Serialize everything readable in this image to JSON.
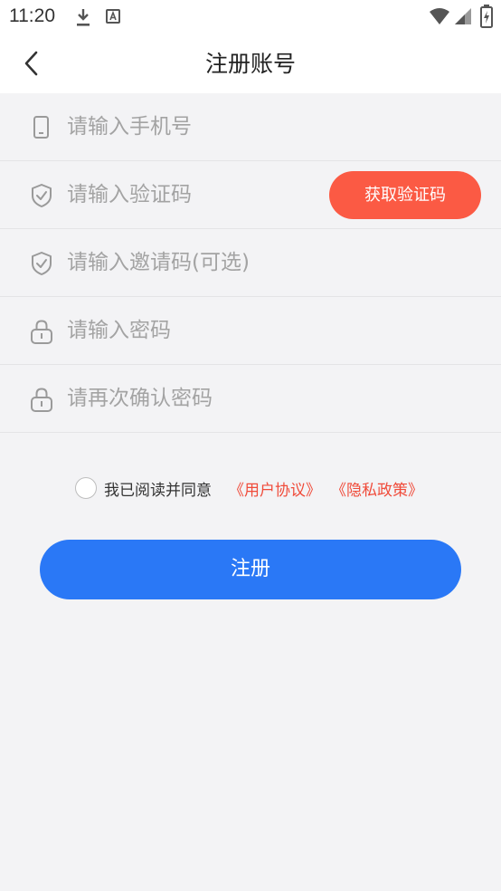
{
  "status_bar": {
    "time": "11:20",
    "icons": [
      "download-icon",
      "a-box-icon",
      "wifi-icon",
      "signal-icon",
      "battery-charging-icon"
    ]
  },
  "header": {
    "back_icon": "chevron-left-icon",
    "title": "注册账号"
  },
  "form": {
    "phone": {
      "icon": "phone-icon",
      "placeholder": "请输入手机号",
      "value": ""
    },
    "code": {
      "icon": "shield-check-icon",
      "placeholder": "请输入验证码",
      "value": "",
      "button_label": "获取验证码"
    },
    "invite": {
      "icon": "shield-check-icon",
      "placeholder": "请输入邀请码(可选)",
      "value": ""
    },
    "password": {
      "icon": "lock-icon",
      "placeholder": "请输入密码",
      "value": ""
    },
    "confirm": {
      "icon": "lock-icon",
      "placeholder": "请再次确认密码",
      "value": ""
    }
  },
  "agreement": {
    "checked": false,
    "text": "我已阅读并同意",
    "user_agreement": "《用户协议》",
    "privacy_policy": "《隐私政策》"
  },
  "submit_label": "注册",
  "colors": {
    "primary": "#2a78f6",
    "accent": "#fb5a44",
    "link": "#f04b3a",
    "background": "#f3f3f5"
  }
}
